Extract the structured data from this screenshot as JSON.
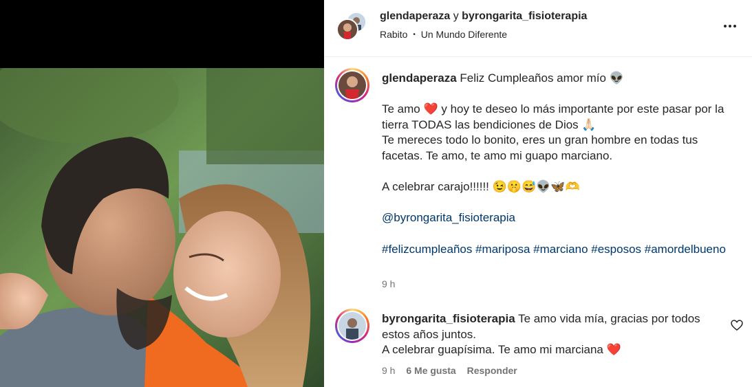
{
  "post": {
    "authors": {
      "primary": "glendaperaza",
      "connector": "y",
      "secondary": "byrongarita_fisioterapia"
    },
    "audio": {
      "song": "Rabito",
      "separator": "•",
      "album": "Un Mundo Diferente"
    },
    "more_icon": "more-horizontal-icon"
  },
  "caption": {
    "username": "glendaperaza",
    "lines": [
      "Feliz Cumpleaños amor mío 👽",
      "",
      "Te amo ❤️ y hoy te deseo lo más importante por este pasar por la tierra TODAS las bendiciones de Dios 🙏🏻",
      "Te mereces todo lo bonito, eres un gran hombre en todas tus facetas. Te amo, te amo mi guapo marciano.",
      "",
      "A celebrar carajo!!!!!! 😉🤫😅👽🦋🫶",
      ""
    ],
    "mention": "@byrongarita_fisioterapia",
    "hashtags": "#felizcumpleaños #mariposa #marciano #esposos #amordelbueno",
    "time": "9 h"
  },
  "reply": {
    "username": "byrongarita_fisioterapia",
    "line1": "Te amo vida mía, gracias por todos estos años juntos.",
    "line2": "A celebrar guapísima. Te amo mi marciana ❤️",
    "time": "9 h",
    "likes": "6 Me gusta",
    "reply_label": "Responder",
    "like_icon": "heart-outline-icon"
  },
  "colors": {
    "link": "#00376b",
    "meta": "#737373",
    "text": "#262626"
  }
}
